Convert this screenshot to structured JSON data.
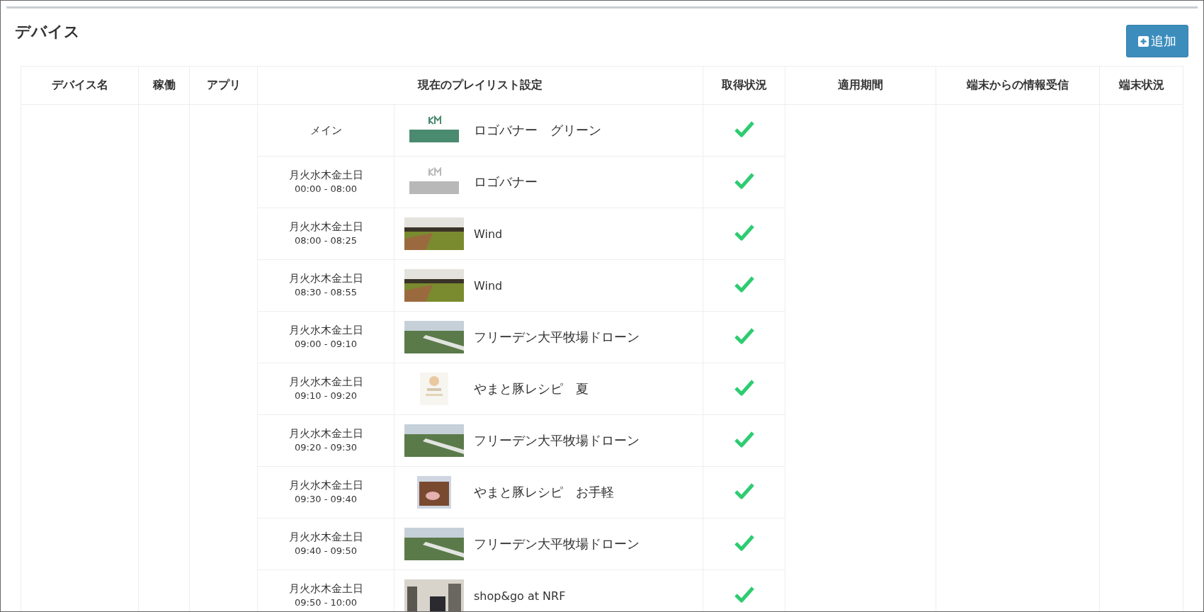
{
  "title": "デバイス",
  "add_button": {
    "label": "追加"
  },
  "columns": [
    "デバイス名",
    "稼働",
    "アプリ",
    "現在のプレイリスト設定",
    "取得状況",
    "適用期間",
    "端末からの情報受信",
    "端末状況"
  ],
  "playlist": [
    {
      "schedule": {
        "kind": "label",
        "text": "メイン"
      },
      "thumb": {
        "kind": "logo",
        "color": "#4a8a6e"
      },
      "content": "ロゴバナー　グリーン",
      "acquired": true
    },
    {
      "schedule": {
        "kind": "time",
        "days": "月火水木金土日",
        "time": "00:00 - 08:00"
      },
      "thumb": {
        "kind": "logo",
        "color": "#b8b8b8"
      },
      "content": "ロゴバナー",
      "acquired": true
    },
    {
      "schedule": {
        "kind": "time",
        "days": "月火水木金土日",
        "time": "08:00 - 08:25"
      },
      "thumb": {
        "kind": "field"
      },
      "content": "Wind",
      "acquired": true
    },
    {
      "schedule": {
        "kind": "time",
        "days": "月火水木金土日",
        "time": "08:30 - 08:55"
      },
      "thumb": {
        "kind": "field"
      },
      "content": "Wind",
      "acquired": true
    },
    {
      "schedule": {
        "kind": "time",
        "days": "月火水木金土日",
        "time": "09:00 - 09:10"
      },
      "thumb": {
        "kind": "aerial"
      },
      "content": "フリーデン大平牧場ドローン",
      "acquired": true
    },
    {
      "schedule": {
        "kind": "time",
        "days": "月火水木金土日",
        "time": "09:10 - 09:20"
      },
      "thumb": {
        "kind": "poster"
      },
      "content": "やまと豚レシピ　夏",
      "acquired": true
    },
    {
      "schedule": {
        "kind": "time",
        "days": "月火水木金土日",
        "time": "09:20 - 09:30"
      },
      "thumb": {
        "kind": "aerial"
      },
      "content": "フリーデン大平牧場ドローン",
      "acquired": true
    },
    {
      "schedule": {
        "kind": "time",
        "days": "月火水木金土日",
        "time": "09:30 - 09:40"
      },
      "thumb": {
        "kind": "food"
      },
      "content": "やまと豚レシピ　お手軽",
      "acquired": true
    },
    {
      "schedule": {
        "kind": "time",
        "days": "月火水木金土日",
        "time": "09:40 - 09:50"
      },
      "thumb": {
        "kind": "aerial"
      },
      "content": "フリーデン大平牧場ドローン",
      "acquired": true
    },
    {
      "schedule": {
        "kind": "time",
        "days": "月火水木金土日",
        "time": "09:50 - 10:00"
      },
      "thumb": {
        "kind": "indoor"
      },
      "content": "shop&go at NRF",
      "acquired": true
    }
  ]
}
